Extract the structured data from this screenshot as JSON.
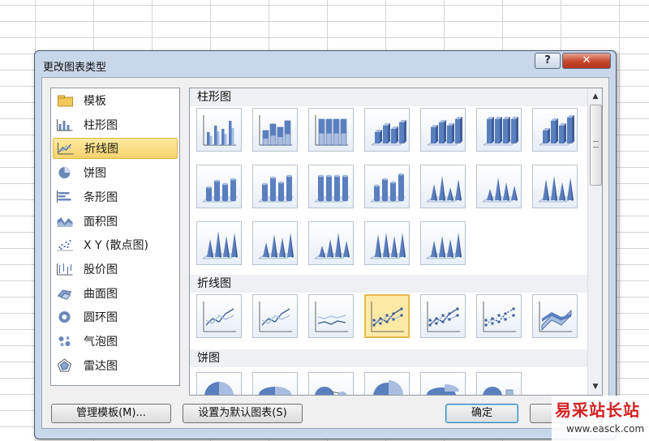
{
  "dialog": {
    "title": "更改图表类型",
    "help_label": "?",
    "close_label": "✕"
  },
  "categories": [
    {
      "label": "模板",
      "icon": "folder-icon",
      "selected": false
    },
    {
      "label": "柱形图",
      "icon": "column-chart-icon",
      "selected": false
    },
    {
      "label": "折线图",
      "icon": "line-chart-icon",
      "selected": true
    },
    {
      "label": "饼图",
      "icon": "pie-chart-icon",
      "selected": false
    },
    {
      "label": "条形图",
      "icon": "bar-chart-icon",
      "selected": false
    },
    {
      "label": "面积图",
      "icon": "area-chart-icon",
      "selected": false
    },
    {
      "label": "X Y (散点图)",
      "icon": "scatter-chart-icon",
      "selected": false
    },
    {
      "label": "股价图",
      "icon": "stock-chart-icon",
      "selected": false
    },
    {
      "label": "曲面图",
      "icon": "surface-chart-icon",
      "selected": false
    },
    {
      "label": "圆环图",
      "icon": "doughnut-chart-icon",
      "selected": false
    },
    {
      "label": "气泡图",
      "icon": "bubble-chart-icon",
      "selected": false
    },
    {
      "label": "雷达图",
      "icon": "radar-chart-icon",
      "selected": false
    }
  ],
  "gallery": {
    "sections": {
      "column": "柱形图",
      "line": "折线图",
      "pie": "饼图"
    },
    "selected_thumbnail": "line-with-markers"
  },
  "buttons": {
    "manage_templates": "管理模板(M)...",
    "set_default": "设置为默认图表(S)",
    "ok": "确定"
  },
  "watermark": {
    "line1": "易采站长站",
    "line2": "www.easck.com"
  },
  "colors": {
    "selection_fill": "#fde9a6",
    "selection_border": "#e6b84c",
    "chart_blue": "#5a7fbf",
    "close_red": "#c6452b"
  }
}
